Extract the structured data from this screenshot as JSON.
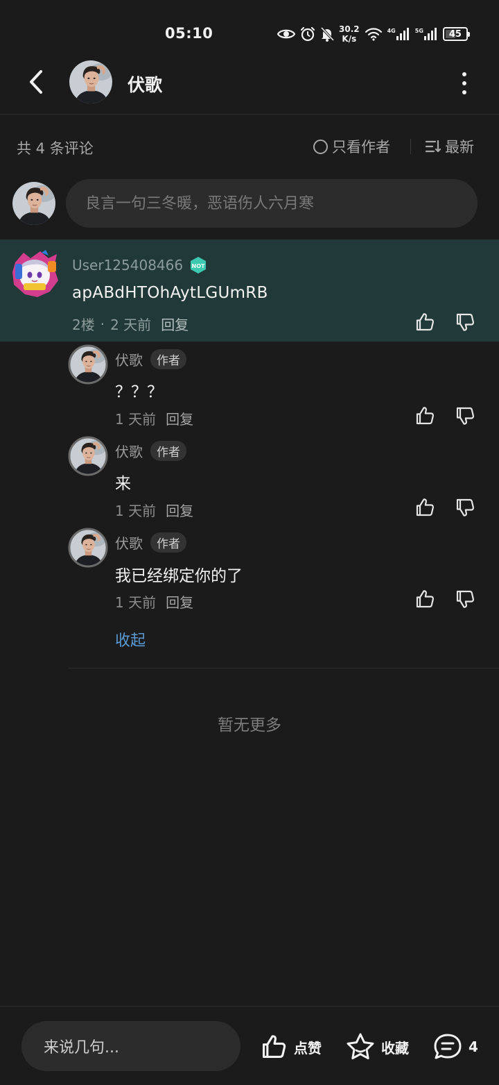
{
  "status_bar": {
    "time": "05:10",
    "net_speed_value": "30.2",
    "net_speed_unit": "K/s",
    "signal1_type": "4G",
    "signal2_type": "5G",
    "battery": "45",
    "icons": [
      "eye-icon",
      "alarm-icon",
      "bell-off-icon",
      "wifi-icon",
      "signal-icon",
      "signal-icon",
      "battery-icon"
    ]
  },
  "header": {
    "title": "伏歌",
    "back_icon": "chevron-left-icon",
    "more_icon": "more-vertical-icon"
  },
  "toolbar": {
    "comment_count": "共 4 条评论",
    "author_only_label": "只看作者",
    "sort_label": "最新"
  },
  "composer": {
    "placeholder": "良言一句三冬暖，恶语伤人六月寒"
  },
  "main_comment": {
    "username": "User125408466",
    "badge": "NOT",
    "text": "apABdHTOhAytLGUmRB",
    "floor": "2楼",
    "separator": "·",
    "time": "2 天前",
    "reply_label": "回复"
  },
  "replies": [
    {
      "name": "伏歌",
      "tag": "作者",
      "text": "？？？",
      "time": "1 天前",
      "reply_label": "回复"
    },
    {
      "name": "伏歌",
      "tag": "作者",
      "text": "来",
      "time": "1 天前",
      "reply_label": "回复"
    },
    {
      "name": "伏歌",
      "tag": "作者",
      "text": "我已经绑定你的了",
      "time": "1 天前",
      "reply_label": "回复"
    }
  ],
  "collapse_label": "收起",
  "no_more_label": "暂无更多",
  "bottom_bar": {
    "input_label": "来说几句...",
    "like_label": "点赞",
    "favorite_label": "收藏",
    "comment_count": "4"
  },
  "colors": {
    "background": "#1b1b1b",
    "highlight": "#213a39",
    "link": "#5b9bd5",
    "badge": "#3cc9b0"
  }
}
